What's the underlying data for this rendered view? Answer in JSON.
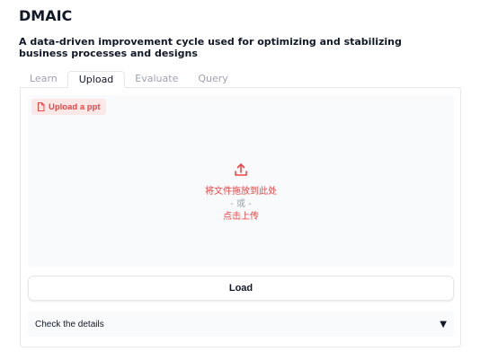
{
  "app": {
    "title": "DMAIC",
    "subtitle": "A data-driven improvement cycle used for optimizing and stabilizing business processes and designs"
  },
  "tabs": [
    {
      "label": "Learn",
      "active": false
    },
    {
      "label": "Upload",
      "active": true
    },
    {
      "label": "Evaluate",
      "active": false
    },
    {
      "label": "Query",
      "active": false
    }
  ],
  "upload": {
    "badge_label": "Upload a ppt",
    "badge_icon": "file-icon",
    "drop_icon": "upload-icon",
    "drop_text": "将文件拖放到此处",
    "or_text": "- 或 -",
    "click_text": "点击上传"
  },
  "load_button": {
    "label": "Load"
  },
  "details": {
    "label": "Check the details",
    "caret": "▼"
  },
  "colors": {
    "accent": "#ef4444",
    "badge_bg": "#fde8e8",
    "muted": "#9ca3af",
    "panel_bg": "#f9fafb"
  }
}
